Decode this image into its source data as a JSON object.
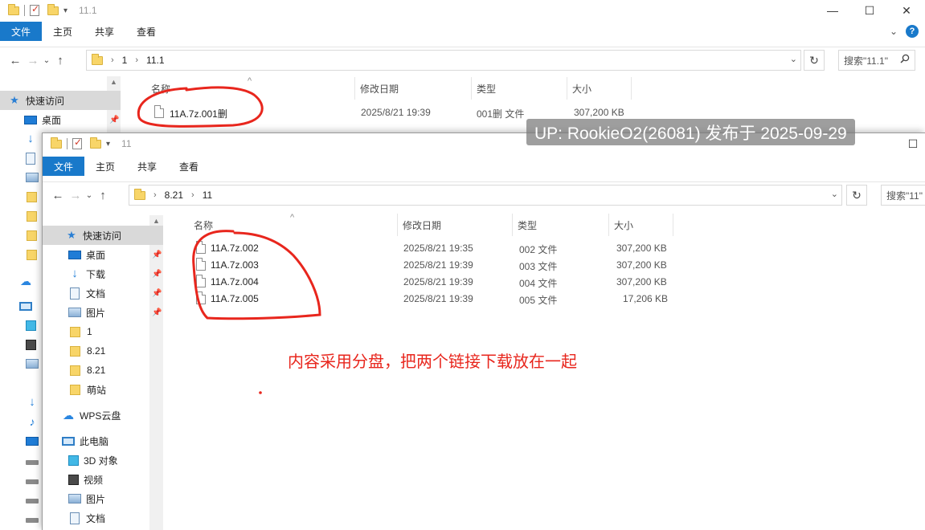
{
  "back_window": {
    "title": "11.1",
    "tabs": [
      "文件",
      "主页",
      "共享",
      "查看"
    ],
    "breadcrumb": [
      "1",
      "11.1"
    ],
    "search_placeholder": "搜索\"11.1\"",
    "columns": [
      "名称",
      "修改日期",
      "类型",
      "大小"
    ],
    "nav": {
      "quick_access": "快速访问",
      "desktop": "桌面"
    },
    "files": [
      {
        "name": "11A.7z.001删",
        "date": "2025/8/21 19:39",
        "type": "001删 文件",
        "size": "307,200 KB"
      }
    ]
  },
  "front_window": {
    "title": "11",
    "tabs": [
      "文件",
      "主页",
      "共享",
      "查看"
    ],
    "breadcrumb": [
      "8.21",
      "11"
    ],
    "search_placeholder": "搜索\"11\"",
    "columns": [
      "名称",
      "修改日期",
      "类型",
      "大小"
    ],
    "nav": [
      {
        "label": "快速访问",
        "icon": "star-icon"
      },
      {
        "label": "桌面",
        "icon": "desktop-icon"
      },
      {
        "label": "下载",
        "icon": "download-icon"
      },
      {
        "label": "文档",
        "icon": "document-icon"
      },
      {
        "label": "图片",
        "icon": "picture-icon"
      },
      {
        "label": "1",
        "icon": "folder-icon"
      },
      {
        "label": "8.21",
        "icon": "folder-icon"
      },
      {
        "label": "8.21",
        "icon": "folder-icon"
      },
      {
        "label": "萌站",
        "icon": "folder-icon"
      },
      {
        "label": "WPS云盘",
        "icon": "cloud-icon"
      },
      {
        "label": "此电脑",
        "icon": "pc-icon"
      },
      {
        "label": "3D 对象",
        "icon": "3d-objects-icon"
      },
      {
        "label": "视频",
        "icon": "video-icon"
      },
      {
        "label": "图片",
        "icon": "picture-icon"
      },
      {
        "label": "文档",
        "icon": "document-icon"
      }
    ],
    "files": [
      {
        "name": "11A.7z.002",
        "date": "2025/8/21 19:35",
        "type": "002 文件",
        "size": "307,200 KB"
      },
      {
        "name": "11A.7z.003",
        "date": "2025/8/21 19:39",
        "type": "003 文件",
        "size": "307,200 KB"
      },
      {
        "name": "11A.7z.004",
        "date": "2025/8/21 19:39",
        "type": "004 文件",
        "size": "307,200 KB"
      },
      {
        "name": "11A.7z.005",
        "date": "2025/8/21 19:39",
        "type": "005 文件",
        "size": "17,206 KB"
      }
    ]
  },
  "watermark": "UP: RookieO2(26081) 发布于 2025-09-29",
  "annotation": "内容采用分盘，把两个链接下载放在一起",
  "annotation_color": "#e8261d",
  "accent_color": "#1979ca"
}
